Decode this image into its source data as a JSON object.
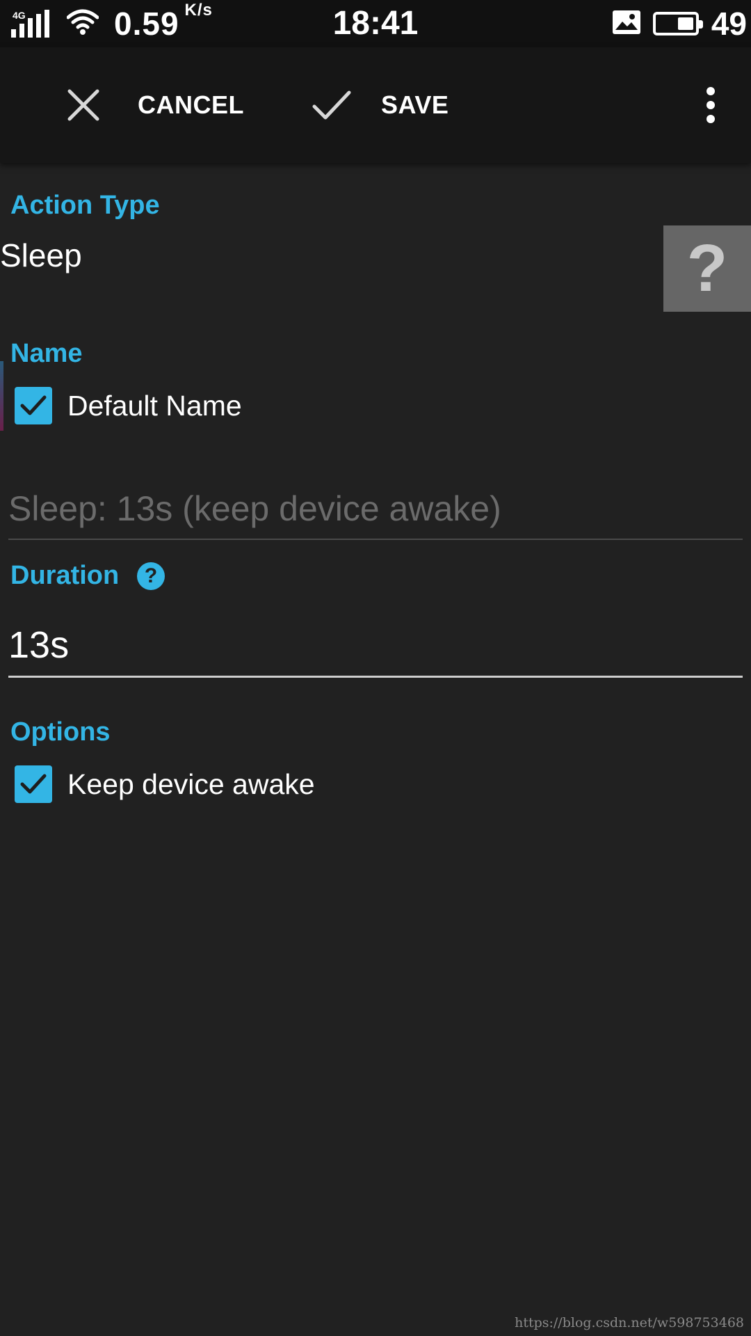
{
  "status_bar": {
    "network_type": "4G",
    "speed_value": "0.59",
    "speed_unit": "K/s",
    "time": "18:41",
    "battery_level": "49",
    "icons": [
      "signal-icon",
      "wifi-icon",
      "image-notification-icon",
      "battery-icon"
    ]
  },
  "toolbar": {
    "cancel_label": "CANCEL",
    "save_label": "SAVE",
    "icons": [
      "close-icon",
      "check-icon",
      "more-vert-icon"
    ]
  },
  "action_type": {
    "title": "Action Type",
    "value": "Sleep",
    "help_symbol": "?"
  },
  "name_section": {
    "title": "Name",
    "default_name_label": "Default Name",
    "default_name_checked": true,
    "name_placeholder": "Sleep: 13s (keep device awake)"
  },
  "duration_section": {
    "title": "Duration",
    "help_symbol": "?",
    "value": "13s"
  },
  "options_section": {
    "title": "Options",
    "keep_awake_label": "Keep device awake",
    "keep_awake_checked": true
  },
  "colors": {
    "accent": "#33b5e5",
    "background": "#212121",
    "toolbar": "#161616"
  },
  "watermark": "https://blog.csdn.net/w598753468"
}
